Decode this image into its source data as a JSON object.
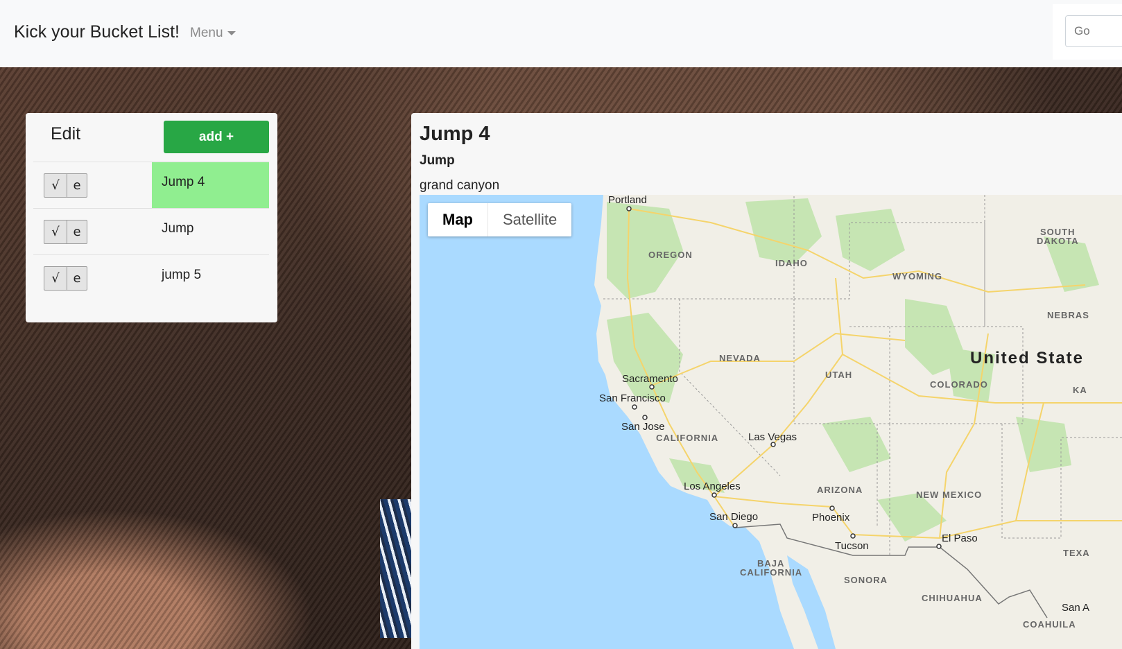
{
  "navbar": {
    "brand": "Kick your Bucket List!",
    "menu_label": "Menu",
    "search_placeholder": "Go"
  },
  "list": {
    "edit_label": "Edit",
    "add_label": "add +",
    "check_symbol": "√",
    "edit_symbol": "e",
    "items": [
      {
        "name": "Jump 4",
        "active": true
      },
      {
        "name": "Jump",
        "active": false
      },
      {
        "name": "jump 5",
        "active": false
      }
    ]
  },
  "detail": {
    "title": "Jump 4",
    "category": "Jump",
    "location": "grand canyon"
  },
  "map": {
    "type_buttons": [
      "Map",
      "Satellite"
    ],
    "selected_type": "Map",
    "country_label": "United State",
    "state_labels": [
      "OREGON",
      "IDAHO",
      "WYOMING",
      "SOUTH",
      "DAKOTA",
      "NEBRAS",
      "NEVADA",
      "UTAH",
      "COLORADO",
      "KA",
      "CALIFORNIA",
      "ARIZONA",
      "NEW MEXICO",
      "TEXA",
      "BAJA",
      "CALIFORNIA",
      "SONORA",
      "CHIHUAHUA",
      "COAHUILA"
    ],
    "city_labels": [
      "Portland",
      "Sacramento",
      "San Francisco",
      "San Jose",
      "Las Vegas",
      "Los Angeles",
      "San Diego",
      "Phoenix",
      "Tucson",
      "El Paso",
      "San A"
    ],
    "colors": {
      "water": "#aadaff",
      "land": "#f1efe7",
      "park": "#c6e5b3",
      "road": "#f5d46b"
    }
  }
}
